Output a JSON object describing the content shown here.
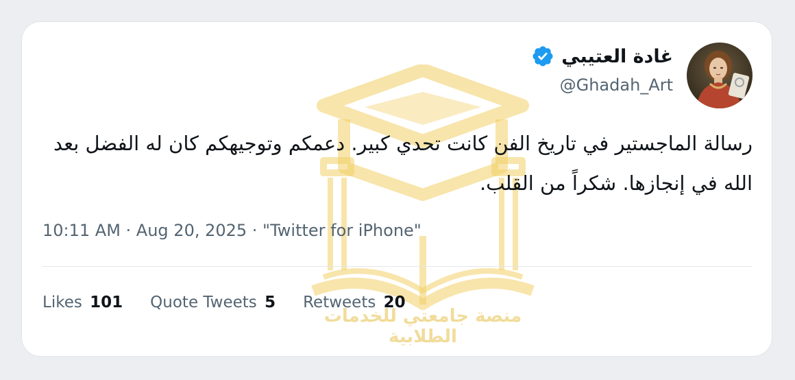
{
  "tweet": {
    "display_name": "غادة العتيبي",
    "handle": "@Ghadah_Art",
    "text": "رسالة الماجستير في تاريخ الفن كانت تحدي كبير. دعمكم وتوجيهكم كان له الفضل بعد الله في إنجازها. شكراً من القلب.",
    "meta": "10:11 AM · Aug 20, 2025 · \"Twitter for iPhone\"",
    "stats": [
      {
        "label": "Likes",
        "value": "101"
      },
      {
        "label": "Quote Tweets",
        "value": "5"
      },
      {
        "label": "Retweets",
        "value": "20"
      }
    ]
  },
  "watermark": {
    "text": "منصة جامعتي للخدمات الطلابية"
  },
  "icons": {
    "verified": "verified-badge-icon",
    "avatar": "renaissance-portrait-avatar",
    "watermark_logo": "graduation-cap-book-logo"
  },
  "colors": {
    "verified_blue": "#1d9bf0",
    "watermark_gold": "#e6b937",
    "text_primary": "#0f1419",
    "text_secondary": "#536471"
  }
}
